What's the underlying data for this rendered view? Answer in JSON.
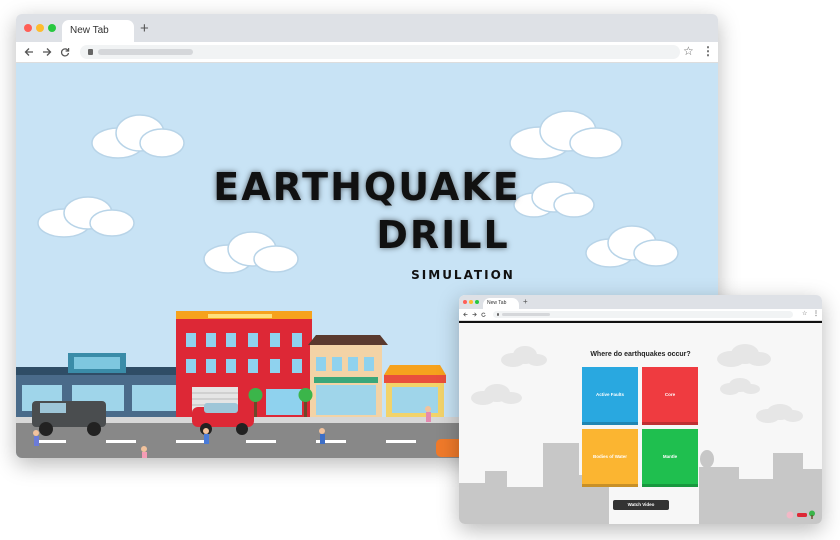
{
  "main_window": {
    "tab_title": "New Tab",
    "new_tab_label": "+",
    "menu_label": "⋮",
    "bookmark_label": "☆"
  },
  "simulation": {
    "title_line1": "EARTHQUAKE",
    "title_line2": "DRILL",
    "subtitle": "SIMULATION"
  },
  "preview_window": {
    "tab_title": "New Tab",
    "new_tab_label": "+",
    "menu_label": "⋮",
    "bookmark_label": "☆",
    "question": "Where do earthquakes occur?",
    "answers": [
      {
        "label": "Active Faults",
        "color": "#29a8e0"
      },
      {
        "label": "Core",
        "color": "#ef3b40"
      },
      {
        "label": "Bodies of Water",
        "color": "#fbb531"
      },
      {
        "label": "Mantle",
        "color": "#1fbf4f"
      }
    ],
    "watch_video_label": "Watch Video"
  },
  "colors": {
    "close": "#ff5f57",
    "minimize": "#febc2e",
    "maximize": "#28c840",
    "sky": "#c8e3f5",
    "road": "#888888"
  }
}
